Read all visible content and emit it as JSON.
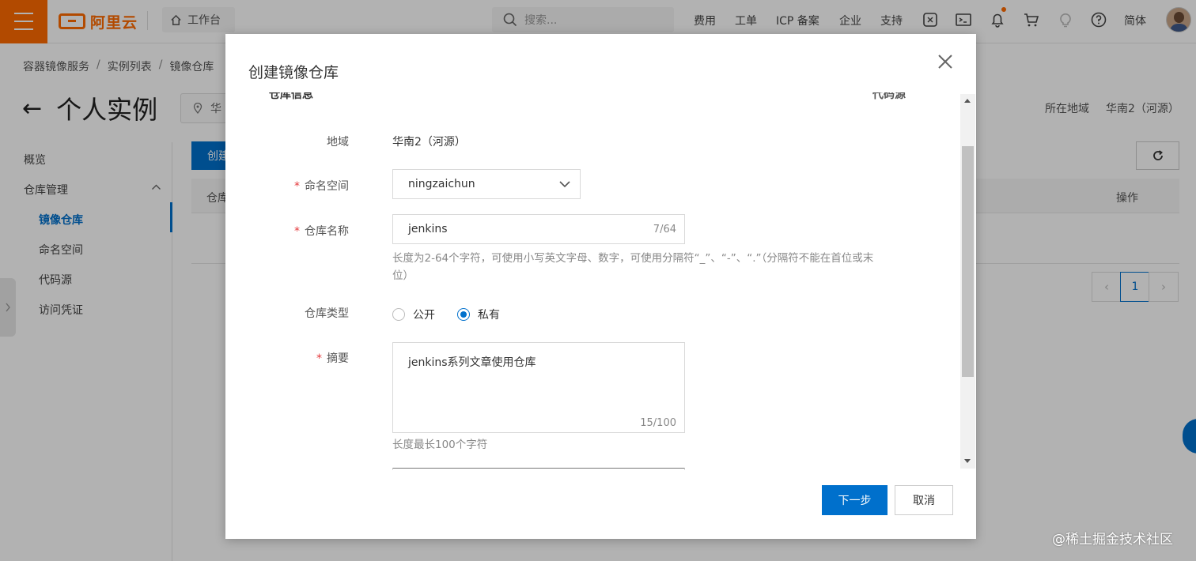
{
  "header": {
    "brand": "阿里云",
    "workbench": "工作台",
    "search_placeholder": "搜索...",
    "nav": [
      "费用",
      "工单",
      "ICP 备案",
      "企业",
      "支持"
    ],
    "language": "简体",
    "icons": [
      "menu-icon",
      "home-icon",
      "search-icon",
      "app-icon",
      "terminal-icon",
      "bell-icon",
      "cart-icon",
      "bulb-icon",
      "help-icon",
      "avatar"
    ]
  },
  "breadcrumb": [
    "容器镜像服务",
    "实例列表",
    "镜像仓库"
  ],
  "page": {
    "back_icon": "←",
    "title": "个人实例",
    "region_pill": "华",
    "region_label": "所在地域",
    "region_value": "华南2（河源）"
  },
  "sidebar": {
    "items": [
      {
        "label": "概览"
      },
      {
        "label": "仓库管理",
        "expanded": true
      },
      {
        "label": "镜像仓库",
        "active": true
      },
      {
        "label": "命名空间"
      },
      {
        "label": "代码源"
      },
      {
        "label": "访问凭证"
      }
    ]
  },
  "toolbar": {
    "create_label": "创建"
  },
  "table": {
    "col_repo": "仓库",
    "col_ops": "操作"
  },
  "pagination": {
    "current_page": "1",
    "prev": "‹",
    "next": "›"
  },
  "dialog": {
    "title": "创建镜像仓库",
    "steps": [
      "仓库信息",
      "代码源"
    ],
    "region_label": "地域",
    "region_value": "华南2（河源）",
    "namespace_label": "命名空间",
    "namespace_value": "ningzaichun",
    "repo_name_label": "仓库名称",
    "repo_name_value": "jenkins",
    "repo_name_count": "7/64",
    "repo_name_hint": "长度为2-64个字符，可使用小写英文字母、数字，可使用分隔符“_”、“-”、“.”（分隔符不能在首位或末位）",
    "repo_type_label": "仓库类型",
    "repo_type_options": [
      "公开",
      "私有"
    ],
    "repo_type_selected": "私有",
    "summary_label": "摘要",
    "summary_value": "jenkins系列文章使用仓库",
    "summary_count": "15/100",
    "summary_hint": "长度最长100个字符",
    "required_mark": "*",
    "next_label": "下一步",
    "cancel_label": "取消"
  },
  "watermark": "@稀土掘金技术社区",
  "colors": {
    "brand_orange": "#ff6a00",
    "primary_blue": "#0070cc",
    "required_red": "#e4393c"
  }
}
